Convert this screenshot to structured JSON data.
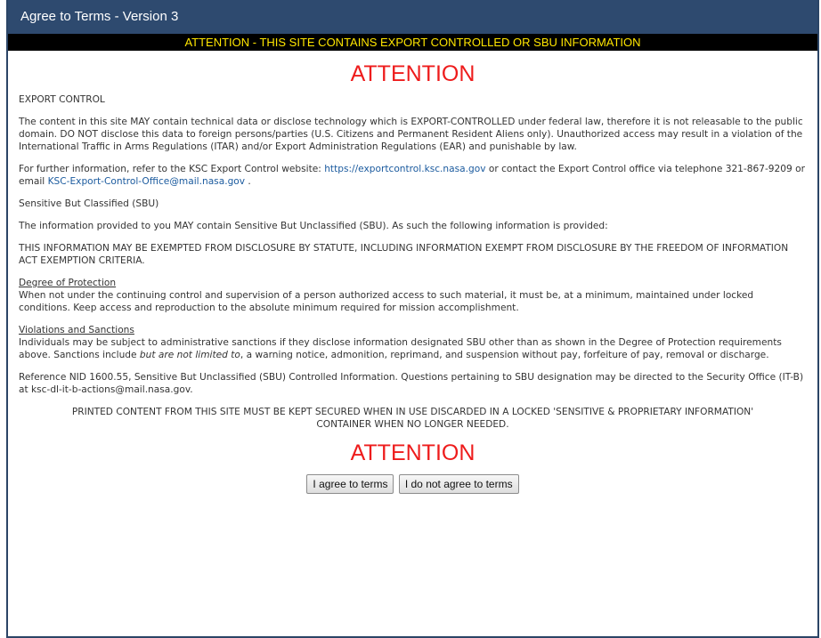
{
  "dialog": {
    "title": "Agree to Terms - Version 3",
    "banner": "ATTENTION - THIS SITE CONTAINS EXPORT CONTROLLED OR SBU INFORMATION"
  },
  "content": {
    "attention_heading": "ATTENTION",
    "export_control_heading": "EXPORT CONTROL",
    "para1": "The content in this site MAY contain technical data or disclose technology which is EXPORT-CONTROLLED under federal law, therefore it is not releasable to the public domain. DO NOT disclose this data to foreign persons/parties (U.S. Citizens and Permanent Resident Aliens only). Unauthorized access may result in a violation of the International Traffic in Arms Regulations (ITAR) and/or Export Administration Regulations (EAR) and punishable by law.",
    "para2_pre": "For further information, refer to the KSC Export Control website: ",
    "para2_link1": "https://exportcontrol.ksc.nasa.gov",
    "para2_mid": " or contact the Export Control office via telephone 321-867-9209 or email ",
    "para2_link2": "KSC-Export-Control-Office@mail.nasa.gov",
    "para2_post": " .",
    "sbu_heading": "Sensitive But Classified (SBU)",
    "sbu_para": "The information provided to you MAY contain Sensitive But Unclassified (SBU). As such the following information is provided:",
    "exempt_para": "THIS INFORMATION MAY BE EXEMPTED FROM DISCLOSURE BY STATUTE, INCLUDING INFORMATION EXEMPT FROM DISCLOSURE BY THE FREEDOM OF INFORMATION ACT EXEMPTION CRITERIA.",
    "degree_heading": "Degree of Protection",
    "degree_text": "When not under the continuing control and supervision of a person authorized access to such material, it must be, at a minimum, maintained under locked conditions. Keep access and reproduction to the absolute minimum required for mission accomplishment.",
    "violations_heading": "Violations and Sanctions",
    "violations_pre": "Individuals may be subject to administrative sanctions if they disclose information designated SBU other than as shown in the Degree of Protection requirements above. Sanctions include ",
    "violations_italic": "but are not limited to",
    "violations_post": ", a warning notice, admonition, reprimand, and suspension without pay, forfeiture of pay, removal or discharge.",
    "reference_para": "Reference NID 1600.55, Sensitive But Unclassified (SBU) Controlled Information. Questions pertaining to SBU designation may be directed to the Security Office (IT-B) at ksc-dl-it-b-actions@mail.nasa.gov.",
    "printed_notice": "PRINTED CONTENT FROM THIS SITE MUST BE KEPT SECURED WHEN IN USE DISCARDED IN A LOCKED 'SENSITIVE & PROPRIETARY INFORMATION' CONTAINER WHEN NO LONGER NEEDED."
  },
  "buttons": {
    "agree": "I agree to terms",
    "disagree": "I do not agree to terms"
  },
  "colors": {
    "titlebar": "#2e4a6f",
    "banner_bg": "#000000",
    "banner_text": "#ffe600",
    "attention": "#ee1c1c",
    "link": "#1a5a9e"
  }
}
